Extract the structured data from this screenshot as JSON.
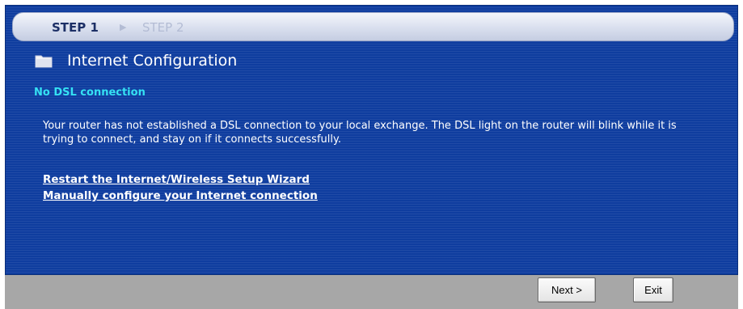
{
  "steps": {
    "active": "STEP 1",
    "inactive": "STEP 2"
  },
  "header": {
    "title": "Internet Configuration",
    "icon": "folder-icon"
  },
  "main": {
    "section_heading": "No DSL connection",
    "description": "Your router has not established a DSL connection to your local exchange. The DSL light on the router will blink while it is trying to connect, and stay on if it connects successfully.",
    "links": [
      "Restart the Internet/Wireless Setup Wizard",
      "Manually configure your Internet connection"
    ]
  },
  "footer": {
    "next_label": "Next >",
    "exit_label": "Exit"
  },
  "colors": {
    "panel_bg": "#0f3d9f",
    "heading_accent": "#35e1f3",
    "footer_bg": "#a7a7a7"
  }
}
